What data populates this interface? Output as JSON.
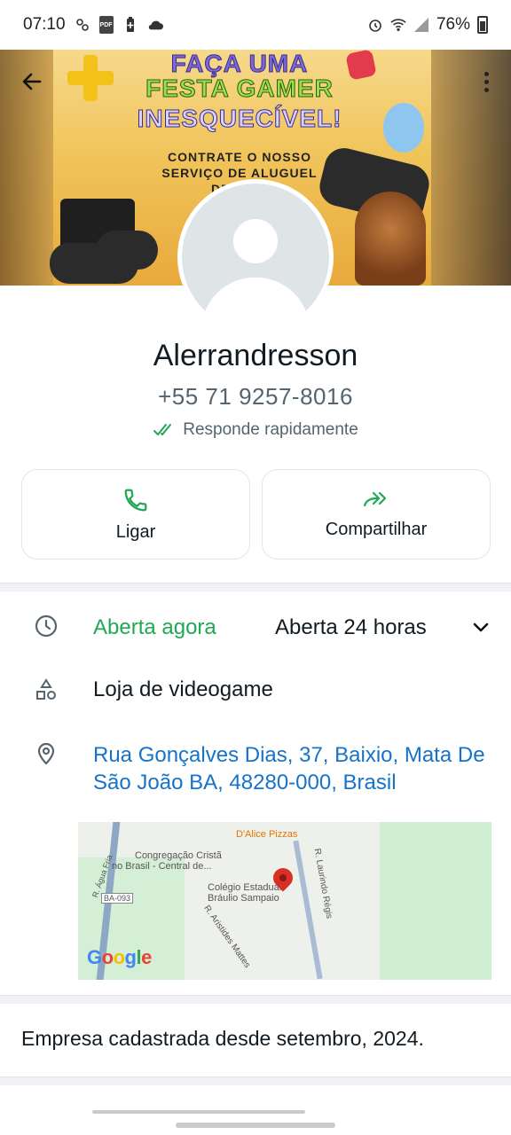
{
  "status_bar": {
    "time": "07:10",
    "battery": "76%",
    "pdf_badge": "PDF",
    "icons": [
      "sync-icon",
      "pdf-icon",
      "battery-saver-icon",
      "cloud-icon",
      "alarm-icon",
      "wifi-icon",
      "signal-icon",
      "battery-icon"
    ]
  },
  "banner": {
    "line1": "FAÇA UMA",
    "line2": "FESTA GAMER",
    "line3": "INESQUECÍVEL!",
    "line4": "CONTRATE O NOSSO",
    "line5": "SERVIÇO DE ALUGUEL",
    "line6": "DE CO..."
  },
  "profile": {
    "name": "Alerrandresson",
    "phone": "+55 71 9257-8016",
    "responds": "Responde rapidamente"
  },
  "actions": {
    "call_label": "Ligar",
    "share_label": "Compartilhar"
  },
  "hours": {
    "status": "Aberta agora",
    "schedule": "Aberta 24 horas"
  },
  "category": "Loja de videogame",
  "address": {
    "line1": "Rua Gonçalves Dias, 37, Baixio, Mata De",
    "line2": "São João BA, 48280-000, Brasil"
  },
  "map": {
    "labels": {
      "pizza": "D'Alice Pizzas",
      "church1": "Congregação Cristã",
      "church2": "no Brasil - Central de...",
      "school1": "Colégio Estadual",
      "school2": "Bráulio Sampaio",
      "street1": "R. Laurindo Régis",
      "street2": "R. Aristides Mattes",
      "road": "BA-093",
      "river": "R. Água Fria"
    },
    "logo": {
      "g1": "G",
      "o1": "o",
      "o2": "o",
      "g2": "g",
      "l": "l",
      "e": "e"
    }
  },
  "since": "Empresa cadastrada desde setembro, 2024.",
  "colors": {
    "accent_green": "#1fa855",
    "link_blue": "#1673c9",
    "text_primary": "#111b21",
    "text_secondary": "#54656f"
  }
}
